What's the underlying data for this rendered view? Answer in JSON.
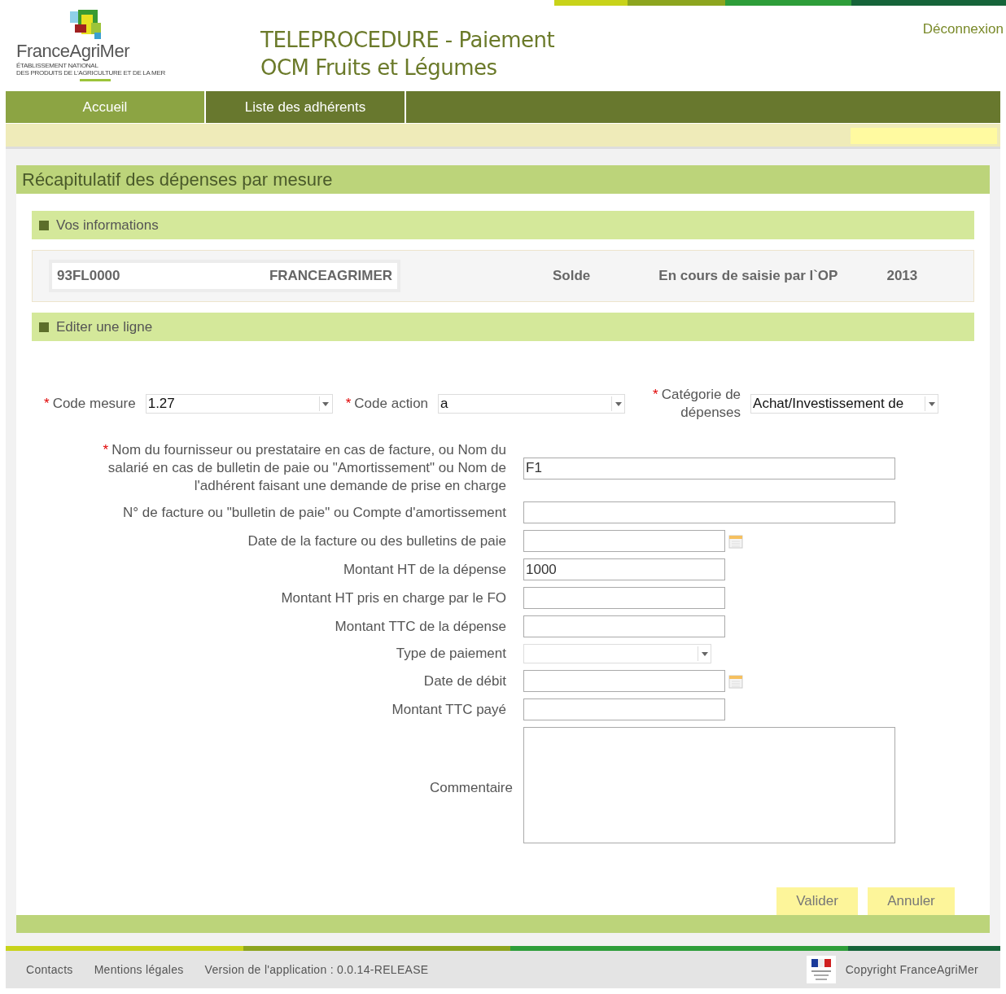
{
  "header": {
    "logo_name": "FranceAgriMer",
    "logo_subtitle": [
      "ÉTABLISSEMENT NATIONAL",
      "DES PRODUITS DE L'AGRICULTURE ET DE LA MER"
    ],
    "title_lines": [
      "TELEPROCEDURE - Paiement",
      "OCM Fruits et Légumes"
    ],
    "logout": "Déconnexion"
  },
  "nav": [
    {
      "label": "Accueil",
      "selected": true
    },
    {
      "label": "Liste des adhérents",
      "selected": false
    }
  ],
  "page_title": "Récapitulatif des dépenses par mesure",
  "info_section": {
    "title": "Vos informations",
    "code": "93FL0000",
    "name": "FRANCEAGRIMER",
    "type": "Solde",
    "status": "En cours de saisie par l`OP",
    "year": "2013"
  },
  "edit_section": {
    "title": "Editer une ligne"
  },
  "top_fields": [
    {
      "mark": "*",
      "label": "Code mesure",
      "value": "1.27"
    },
    {
      "mark": "*",
      "label": "Code action",
      "value": "a"
    },
    {
      "mark": "*",
      "label": "Catégorie de dépenses",
      "value": "Achat/Investissement de"
    }
  ],
  "fields": [
    {
      "kind": "widetext",
      "mark": "*",
      "label": "Nom du fournisseur ou prestataire en cas de facture, ou Nom du salarié en cas de bulletin de paie ou \"Amortissement\" ou Nom de l'adhérent faisant une demande de prise en charge",
      "value": "F1"
    },
    {
      "kind": "widetext",
      "label": "N° de facture ou \"bulletin de paie\" ou Compte d'amortissement"
    },
    {
      "kind": "date",
      "label": "Date de la facture ou des bulletins de paie"
    },
    {
      "kind": "text",
      "label": "Montant HT de la dépense",
      "value": "1000"
    },
    {
      "kind": "text",
      "label": "Montant HT pris en charge par le FO"
    },
    {
      "kind": "text",
      "label": "Montant TTC de la dépense"
    },
    {
      "kind": "select",
      "label": "Type de paiement"
    },
    {
      "kind": "date",
      "label": "Date de débit"
    },
    {
      "kind": "text",
      "label": "Montant TTC payé"
    },
    {
      "kind": "textarea",
      "label": "Commentaire"
    }
  ],
  "buttons": [
    "Valider",
    "Annuler"
  ],
  "footer": {
    "links": [
      "Contacts",
      "Mentions légales"
    ],
    "version": "Version de l'application : 0.0.14-RELEASE",
    "copyright": "Copyright FranceAgriMer"
  }
}
